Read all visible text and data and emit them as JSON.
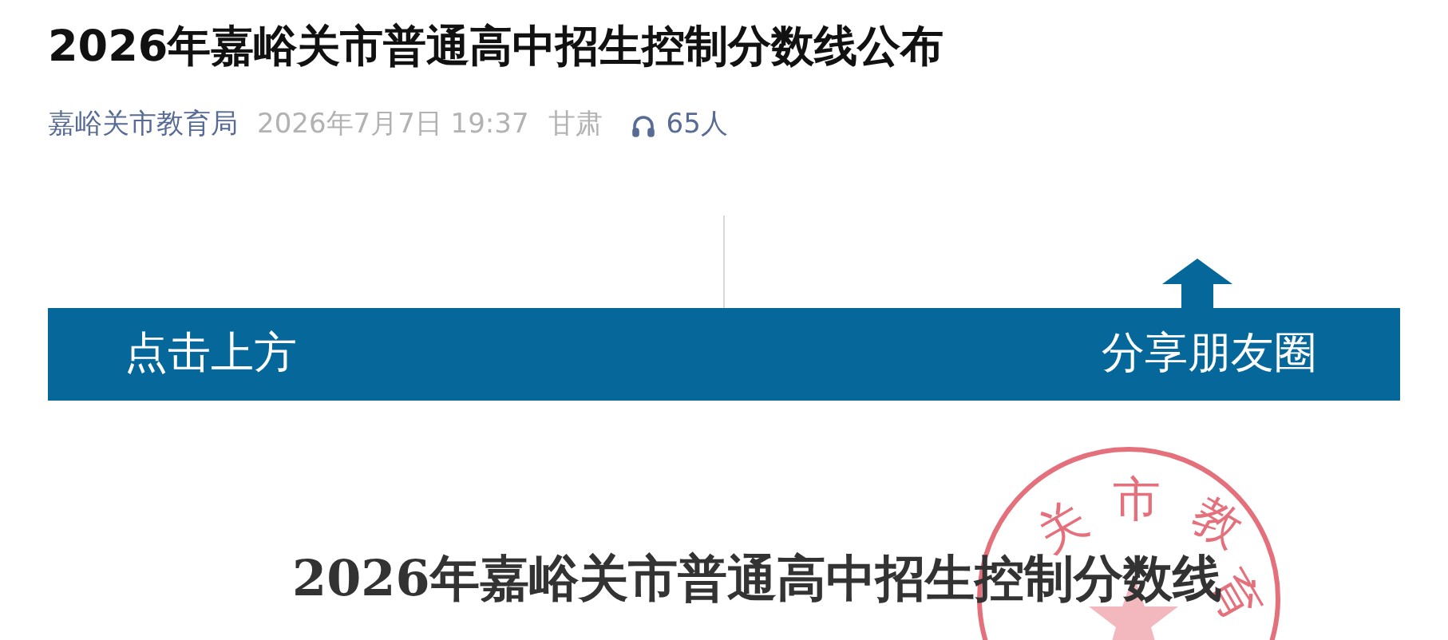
{
  "article": {
    "title": "2026年嘉峪关市普通高中招生控制分数线公布",
    "author": "嘉峪关市教育局",
    "date": "2026年7月7日 19:37",
    "location": "甘肃",
    "listeners": "65人"
  },
  "banner": {
    "left_text": "点击上方",
    "right_text": "分享朋友圈"
  },
  "document": {
    "title": "2026年嘉峪关市普通高中招生控制分数线",
    "seal_chars": [
      "关",
      "市",
      "教",
      "育"
    ]
  }
}
